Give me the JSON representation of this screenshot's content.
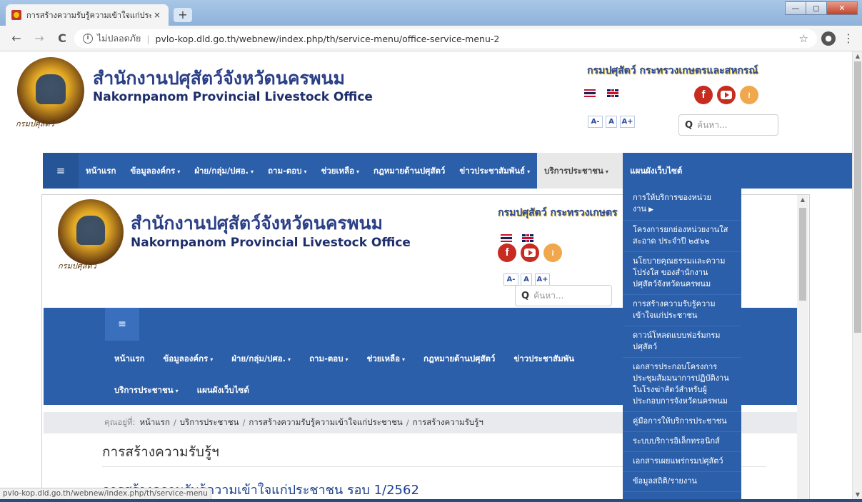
{
  "browser": {
    "tab_title": "การสร้างความรับรู้ความเข้าใจแก่ประชา",
    "tab_close": "×",
    "new_tab": "+",
    "window_minimize": "—",
    "window_maximize": "◻",
    "window_close": "✕",
    "back": "←",
    "forward": "→",
    "reload": "C",
    "not_secure": "ไม่ปลอดภัย",
    "url": "pvlo-kop.dld.go.th/webnew/index.php/th/service-menu/office-service-menu-2",
    "bookmark": "☆",
    "profile": "●",
    "menu": "⋮",
    "status_url": "pvlo-kop.dld.go.th/webnew/index.php/th/service-menu"
  },
  "header": {
    "title_th": "สำนักงานปศุสัตว์จังหวัดนครพนม",
    "title_en": "Nakornpanom Provincial Livestock Office",
    "logo_script": "กรมปศุสัตว์",
    "department": "กรมปศุสัตว์  กระทรวงเกษตรและสหกรณ์",
    "department_clipped": "กรมปศุสัตว์  กระทรวงเกษตร",
    "font_small": "A-",
    "font_normal": "A",
    "font_large": "A+",
    "social_facebook": "f",
    "social_rss": "≀",
    "search_placeholder": "ค้นหา...",
    "search_icon": "Q"
  },
  "nav": {
    "toggle": "≡",
    "items": [
      {
        "label": "หน้าแรก",
        "dropdown": false
      },
      {
        "label": "ข้อมูลองค์กร",
        "dropdown": true
      },
      {
        "label": "ฝ่าย/กลุ่ม/ปศอ.",
        "dropdown": true
      },
      {
        "label": "ถาม-ตอบ",
        "dropdown": true
      },
      {
        "label": "ช่วยเหลือ",
        "dropdown": true
      },
      {
        "label": "กฎหมายด้านปศุสัตว์",
        "dropdown": false
      },
      {
        "label": "ข่าวประชาสัมพันธ์",
        "dropdown": true
      },
      {
        "label": "บริการประชาชน",
        "dropdown": true
      },
      {
        "label": "แผนผังเว็บไซต์",
        "dropdown": false
      }
    ],
    "caret": "▾",
    "inner_clipped_news": "ข่าวประชาสัมพัน"
  },
  "dropdown": {
    "items": [
      "การให้บริการของหน่วยงาน",
      "โครงการยกย่องหน่วยงานใสสะอาด ประจำปี ๒๕๖๒",
      "นโยบายคุณธรรมและความโปร่งใส ของสำนักงานปศุสัตว์จังหวัดนครพนม",
      "การสร้างความรับรู้ความเข้าใจแก่ประชาชน",
      "ดาวน์โหลดแบบฟอร์มกรมปศุสัตว์",
      "เอกสารประกอบโครงการประชุมสัมมนาการปฏิบัติงานในโรงฆ่าสัตว์สำหรับผู้ประกอบการจังหวัดนครพนม",
      "คู่มือการให้บริการประชาชน",
      "ระบบบริการอิเล็กทรอนิกส์",
      "เอกสารเผยแพร่กรมปศุสัตว์",
      "ข้อมูลสถิติ/รายงาน"
    ],
    "submenu_arrow": "▶"
  },
  "content": {
    "breadcrumb_label": "คุณอยู่ที่:",
    "breadcrumb": [
      "หน้าแรก",
      "บริการประชาชน",
      "การสร้างความรับรู้ความเข้าใจแก่ประชาชน",
      "การสร้างความรับรู้ฯ"
    ],
    "breadcrumb_sep": "/",
    "heading": "การสร้างความรับรู้ฯ",
    "article_title": "การสร้างความรับรู้ความเข้าใจแก่ประชาชน รอบ 1/2562"
  },
  "colors": {
    "navbar": "#2c5faa",
    "title": "#2b3f87",
    "accent_red": "#c72c20",
    "rss": "#f1a74b"
  }
}
